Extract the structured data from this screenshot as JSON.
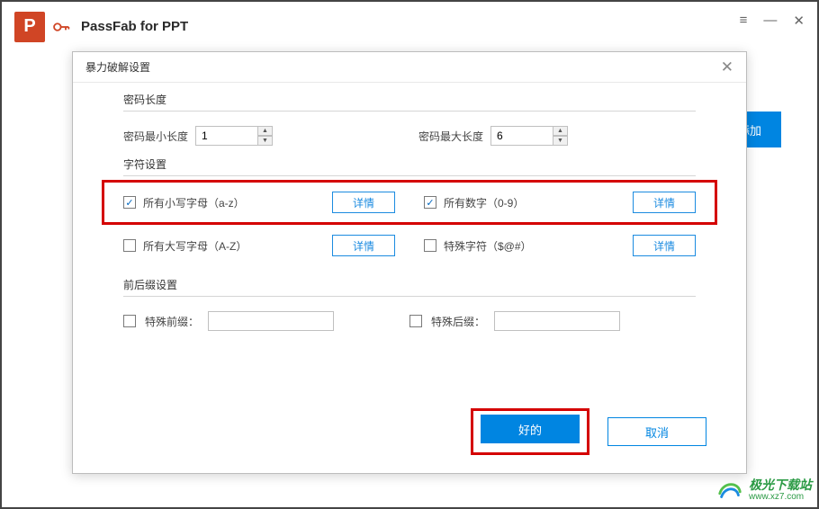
{
  "app": {
    "title": "PassFab for PPT",
    "logo_letter": "P"
  },
  "main": {
    "add_button": "添加"
  },
  "dialog": {
    "title": "暴力破解设置",
    "sections": {
      "length": {
        "label": "密码长度",
        "min_label": "密码最小长度",
        "min_value": "1",
        "max_label": "密码最大长度",
        "max_value": "6"
      },
      "chars": {
        "label": "字符设置",
        "lowercase": {
          "label": "所有小写字母（a-z）",
          "checked": true
        },
        "digits": {
          "label": "所有数字（0-9）",
          "checked": true
        },
        "uppercase": {
          "label": "所有大写字母（A-Z）",
          "checked": false
        },
        "special": {
          "label": "特殊字符（$@#）",
          "checked": false
        },
        "detail_btn": "详情"
      },
      "affix": {
        "label": "前后缀设置",
        "prefix_label": "特殊前缀：",
        "suffix_label": "特殊后缀：",
        "prefix_value": "",
        "suffix_value": ""
      }
    },
    "ok": "好的",
    "cancel": "取消"
  },
  "watermark": {
    "cn": "极光下载站",
    "url": "www.xz7.com"
  }
}
